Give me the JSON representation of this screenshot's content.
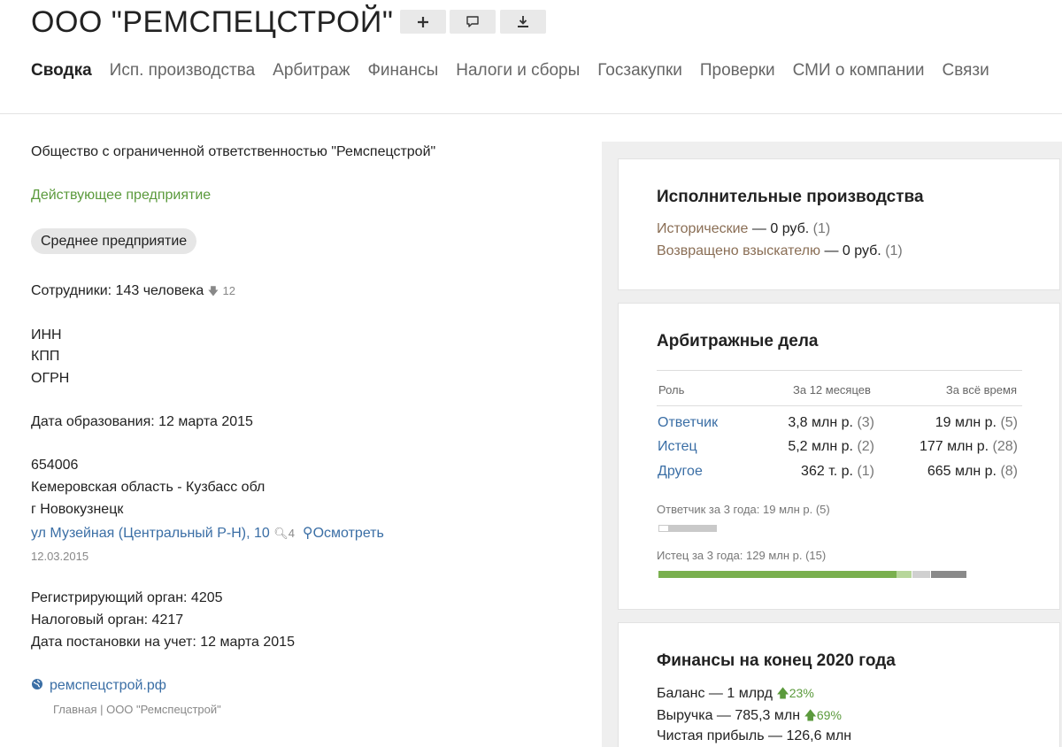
{
  "header": {
    "title": "ООО \"РЕМСПЕЦСТРОЙ\"",
    "tools": [
      "plus-icon",
      "comment-icon",
      "download-icon"
    ]
  },
  "nav": {
    "items": [
      {
        "label": "Сводка",
        "active": true
      },
      {
        "label": "Исп. производства"
      },
      {
        "label": "Арбитраж"
      },
      {
        "label": "Финансы"
      },
      {
        "label": "Налоги и сборы"
      },
      {
        "label": "Госзакупки"
      },
      {
        "label": "Проверки"
      },
      {
        "label": "СМИ о компании"
      },
      {
        "label": "Связи"
      }
    ]
  },
  "summary": {
    "full_name": "Общество с ограниченной ответственностью \"Ремспецстрой\"",
    "status": "Действующее предприятие",
    "size_badge": "Среднее предприятие",
    "employees_label": "Сотрудники: 143 человека",
    "employees_change": "12",
    "inn_label": "ИНН",
    "kpp_label": "КПП",
    "ogrn_label": "ОГРН",
    "founded": "Дата образования: 12 марта 2015",
    "postcode": "654006",
    "region": "Кемеровская область - Кузбасс обл",
    "city": "г Новокузнецк",
    "street": "ул Музейная (Центральный Р-Н), 10",
    "street_search_count": "4",
    "view_label": "Осмотреть",
    "address_date": "12.03.2015",
    "reg_body": "Регистрирующий орган: 4205",
    "tax_body": "Налоговый орган: 4217",
    "reg_date": "Дата постановки на учет: 12 марта 2015",
    "website": "ремспецстрой.рф",
    "website_desc": "Главная | ООО \"Ремспецстрой\""
  },
  "enforcement": {
    "title": "Исполнительные производства",
    "historic_label": "Исторические",
    "historic_value": " — 0 руб.",
    "historic_count": " (1)",
    "returned_label": "Возвращено взыскателю",
    "returned_value": " — 0 руб.",
    "returned_count": " (1)"
  },
  "arbitration": {
    "title": "Арбитражные дела",
    "headers": {
      "role": "Роль",
      "year": "За 12 месяцев",
      "all": "За всё время"
    },
    "rows": [
      {
        "role": "Ответчик",
        "year": "3,8 млн р.",
        "year_count": "(3)",
        "all": "19 млн р.",
        "all_count": "(5)"
      },
      {
        "role": "Истец",
        "year": "5,2 млн р.",
        "year_count": "(2)",
        "all": "177 млн р.",
        "all_count": "(28)"
      },
      {
        "role": "Другое",
        "year": "362 т. р.",
        "year_count": "(1)",
        "all": "665 млн р.",
        "all_count": "(8)"
      }
    ],
    "defendant_3y": "Ответчик за 3 года: 19 млн р. (5)",
    "plaintiff_3y": "Истец за 3 года: 129 млн р. (15)",
    "colors": {
      "green": "#7ab04f",
      "light_green": "#b7d69b",
      "light_grey": "#d0d0d0",
      "dark_grey": "#8a8a8a"
    }
  },
  "finance": {
    "title": "Финансы на конец 2020 года",
    "balance": "Баланс — 1 млрд",
    "balance_change": "23%",
    "revenue": "Выручка — 785,3 млн",
    "revenue_change": "69%",
    "profit": "Чистая прибыль — 126,6 млн"
  }
}
